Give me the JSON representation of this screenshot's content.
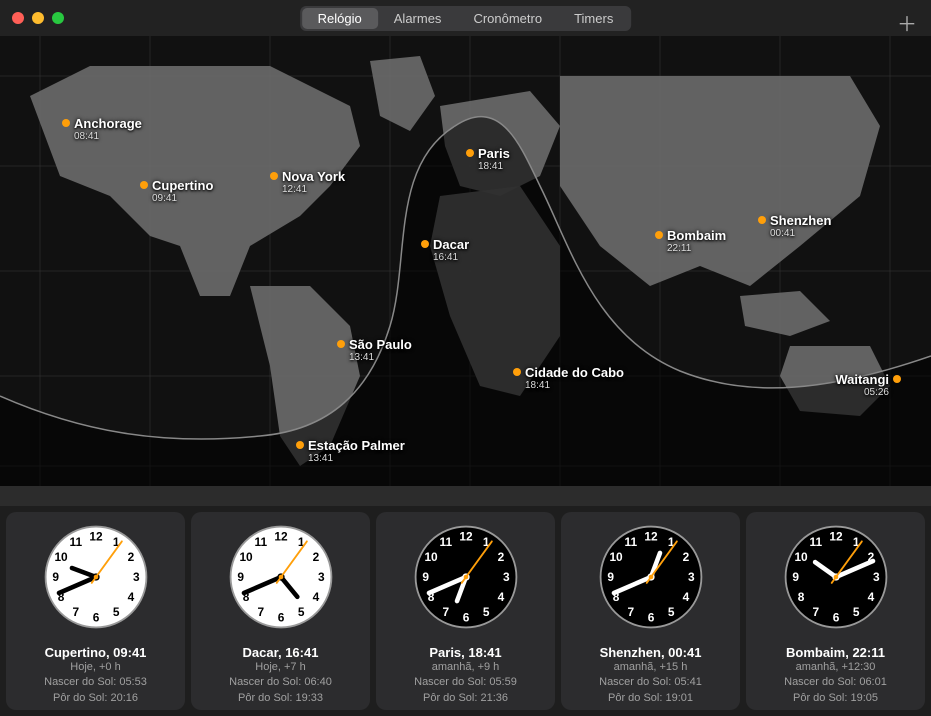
{
  "tabs": {
    "relogio": "Relógio",
    "alarmes": "Alarmes",
    "cronometro": "Cronômetro",
    "timers": "Timers"
  },
  "map_cities": {
    "anchorage": {
      "name": "Anchorage",
      "time": "08:41"
    },
    "cupertino": {
      "name": "Cupertino",
      "time": "09:41"
    },
    "novayork": {
      "name": "Nova York",
      "time": "12:41"
    },
    "saopaulo": {
      "name": "São Paulo",
      "time": "13:41"
    },
    "palmer": {
      "name": "Estação Palmer",
      "time": "13:41"
    },
    "dacar": {
      "name": "Dacar",
      "time": "16:41"
    },
    "paris": {
      "name": "Paris",
      "time": "18:41"
    },
    "cabo": {
      "name": "Cidade do Cabo",
      "time": "18:41"
    },
    "bombaim": {
      "name": "Bombaim",
      "time": "22:11"
    },
    "shenzhen": {
      "name": "Shenzhen",
      "time": "00:41"
    },
    "waitangi": {
      "name": "Waitangi",
      "time": "05:26"
    }
  },
  "clocks": [
    {
      "city_time": "Cupertino, 09:41",
      "offset": "Hoje, +0 h",
      "sunrise": "Nascer do Sol: 05:53",
      "sunset": "Pôr do Sol: 20:16",
      "h": 9,
      "m": 41,
      "s": 6,
      "mode": "day"
    },
    {
      "city_time": "Dacar, 16:41",
      "offset": "Hoje, +7 h",
      "sunrise": "Nascer do Sol: 06:40",
      "sunset": "Pôr do Sol: 19:33",
      "h": 16,
      "m": 41,
      "s": 6,
      "mode": "day"
    },
    {
      "city_time": "Paris, 18:41",
      "offset": "amanhã, +9 h",
      "sunrise": "Nascer do Sol: 05:59",
      "sunset": "Pôr do Sol: 21:36",
      "h": 18,
      "m": 41,
      "s": 6,
      "mode": "night"
    },
    {
      "city_time": "Shenzhen, 00:41",
      "offset": "amanhã, +15 h",
      "sunrise": "Nascer do Sol: 05:41",
      "sunset": "Pôr do Sol: 19:01",
      "h": 0,
      "m": 41,
      "s": 6,
      "mode": "night"
    },
    {
      "city_time": "Bombaim, 22:11",
      "offset": "amanhã, +12:30",
      "sunrise": "Nascer do Sol: 06:01",
      "sunset": "Pôr do Sol: 19:05",
      "h": 22,
      "m": 11,
      "s": 6,
      "mode": "night"
    }
  ]
}
